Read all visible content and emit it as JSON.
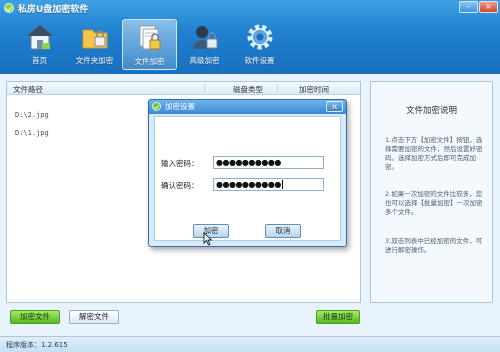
{
  "app": {
    "title": "私房U盘加密软件"
  },
  "window_controls": {
    "minimize": "–",
    "close": "×"
  },
  "nav": [
    {
      "label": "首页",
      "icon": "home-icon"
    },
    {
      "label": "文件夹加密",
      "icon": "folder-lock-icon"
    },
    {
      "label": "文件加密",
      "icon": "file-lock-icon",
      "active": true
    },
    {
      "label": "高级加密",
      "icon": "user-lock-icon"
    },
    {
      "label": "软件设置",
      "icon": "gear-icon"
    }
  ],
  "table": {
    "headers": [
      "文件路径",
      "磁盘类型",
      "加密时间"
    ],
    "rows": [
      {
        "path": "D:\\2.jpg"
      },
      {
        "path": "D:\\1.jpg"
      }
    ]
  },
  "info": {
    "title": "文件加密说明",
    "paragraphs": [
      "1.点击下方【加密文件】按钮，选择需要加密的文件，然后设置好密码。选择加密方式后即可完成加密。",
      "2.如果一次加密的文件比较多，您也可以选择【批量加密】一次加密多个文件。",
      "3.双击列表中已经加密的文件，可进行解密操作。"
    ]
  },
  "buttons": {
    "encrypt_file": "加密文件",
    "decrypt_file": "解密文件",
    "batch_encrypt": "批量加密"
  },
  "footer": {
    "version": "程序版本：1.2.615"
  },
  "dialog": {
    "title": "加密设置",
    "close": "×",
    "password_label": "输入密码：",
    "confirm_label": "确认密码：",
    "password_value": "●●●●●●●●●●",
    "confirm_value": "●●●●●●●●●●",
    "ok_button": "加密",
    "cancel_button": "取消"
  }
}
